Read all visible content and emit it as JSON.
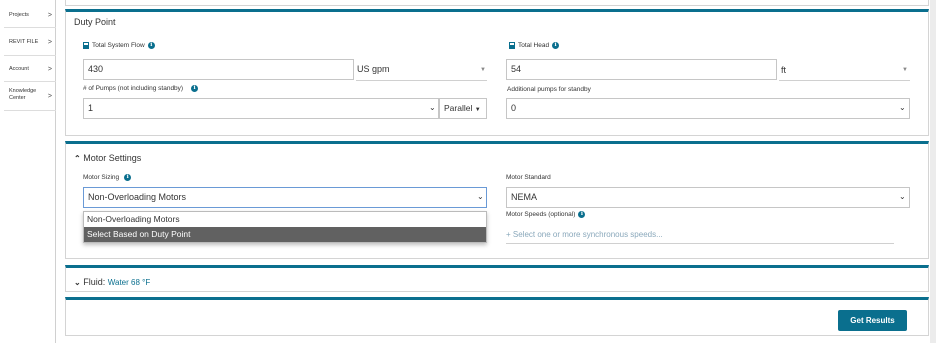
{
  "sidebar": {
    "items": [
      {
        "label": "Projects"
      },
      {
        "label": "REVIT FILE"
      },
      {
        "label": "Account"
      },
      {
        "label_line1": "Knowledge",
        "label_line2": "Center"
      }
    ],
    "chevron": ">"
  },
  "duty_point": {
    "title": "Duty Point",
    "total_system_flow": {
      "label": "Total System Flow",
      "value": "430",
      "unit": "US gpm"
    },
    "total_head": {
      "label": "Total Head",
      "value": "54",
      "unit": "ft"
    },
    "num_pumps": {
      "label": "# of Pumps (not including standby)",
      "value": "1",
      "arrangement": "Parallel"
    },
    "additional_pumps": {
      "label": "Additional pumps for standby",
      "value": "0"
    }
  },
  "motor_settings": {
    "title": "Motor Settings",
    "motor_sizing": {
      "label": "Motor Sizing",
      "value": "Non-Overloading Motors",
      "options": [
        "Non-Overloading Motors",
        "Select Based on Duty Point"
      ],
      "highlighted_index": 1
    },
    "motor_standard": {
      "label": "Motor Standard",
      "value": "NEMA"
    },
    "motor_speeds": {
      "label": "Motor Speeds (optional)",
      "placeholder": "+ Select one or more synchronous speeds..."
    }
  },
  "fluid": {
    "label": "Fluid:",
    "value": "Water 68 °F"
  },
  "actions": {
    "get_results": "Get Results"
  },
  "colors": {
    "accent": "#0a6f8e",
    "highlight": "#616161"
  }
}
